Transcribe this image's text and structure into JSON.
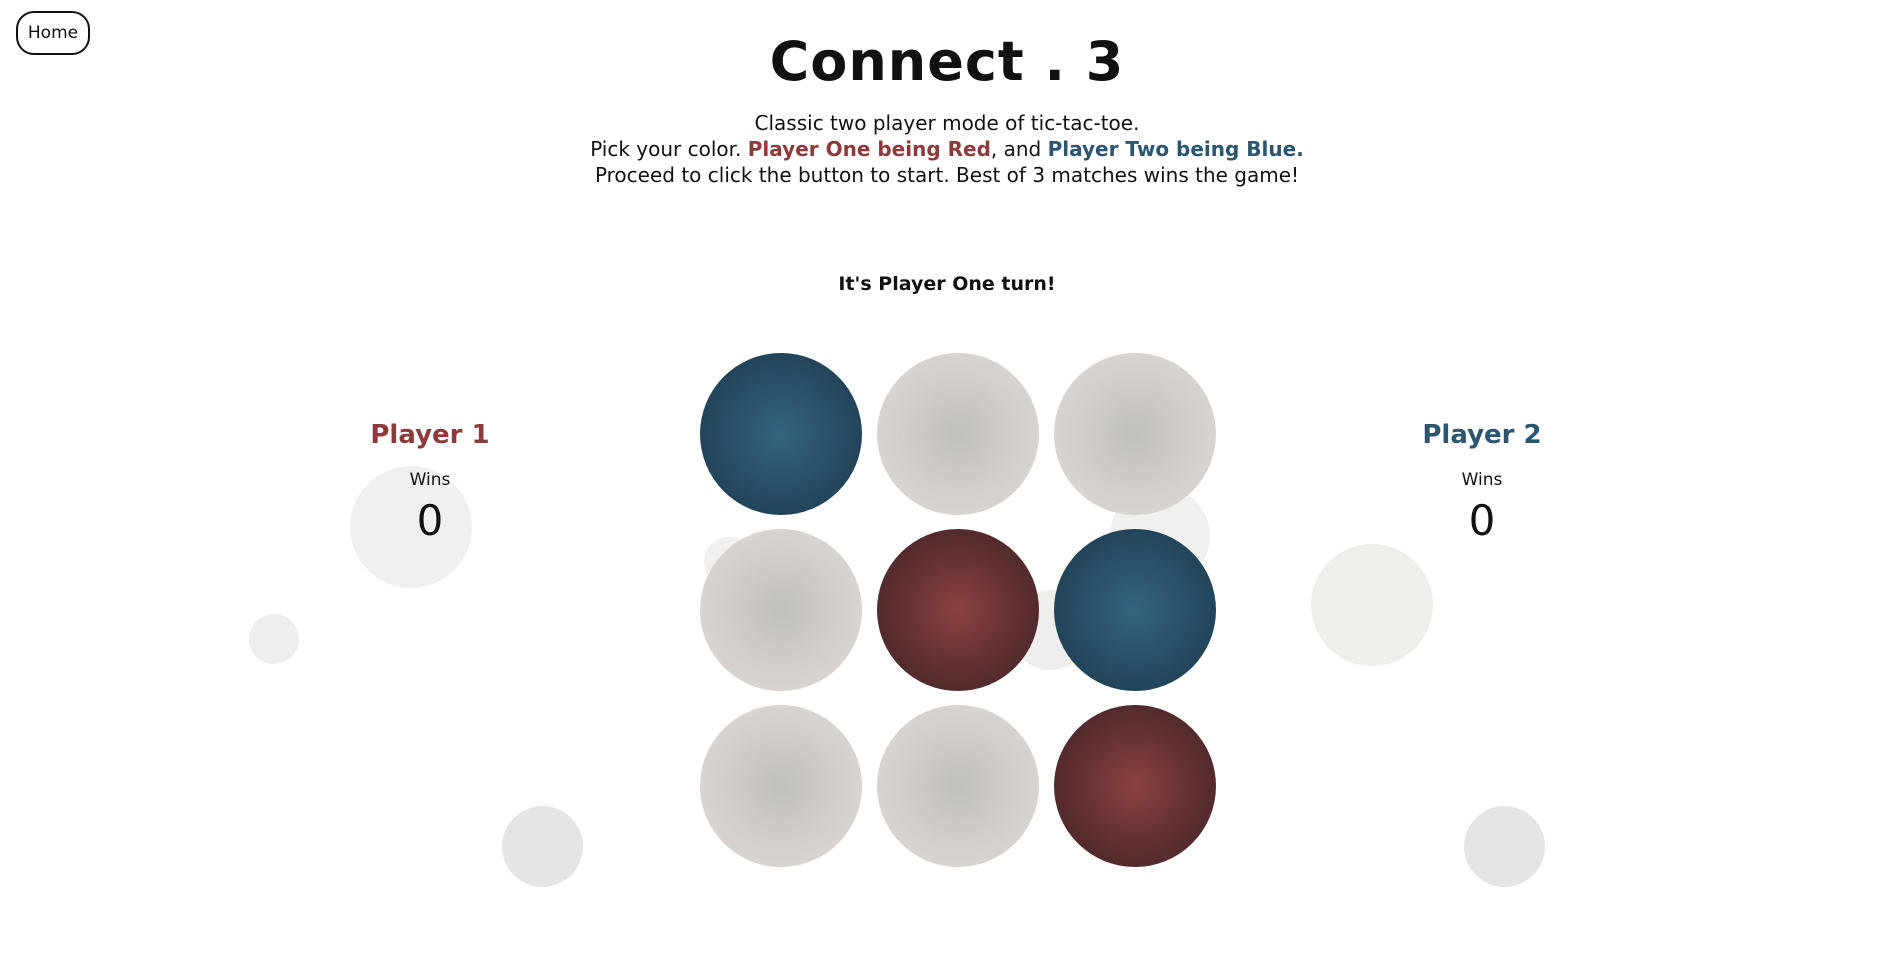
{
  "nav": {
    "home_label": "Home"
  },
  "header": {
    "title": "Connect . 3",
    "line1": "Classic two player mode of tic-tac-toe.",
    "line2_prefix": "Pick your color. ",
    "line2_red": "Player One being Red",
    "line2_mid": ", and ",
    "line2_blue": "Player Two being Blue.",
    "line3": "Proceed to click the button to start. Best of 3 matches wins the game!"
  },
  "status": {
    "turn_text": "It's Player One turn!"
  },
  "players": [
    {
      "name": "Player 1",
      "wins_label": "Wins",
      "wins": "0",
      "color": "#8c3a3b"
    },
    {
      "name": "Player 2",
      "wins_label": "Wins",
      "wins": "0",
      "color": "#2c5670"
    }
  ],
  "board": {
    "cells": [
      "blue",
      "empty",
      "empty",
      "empty",
      "red",
      "blue",
      "empty",
      "empty",
      "red"
    ]
  },
  "colors": {
    "red": "#8c3a3b",
    "blue": "#2c5670",
    "empty": "#d4d0cb"
  }
}
